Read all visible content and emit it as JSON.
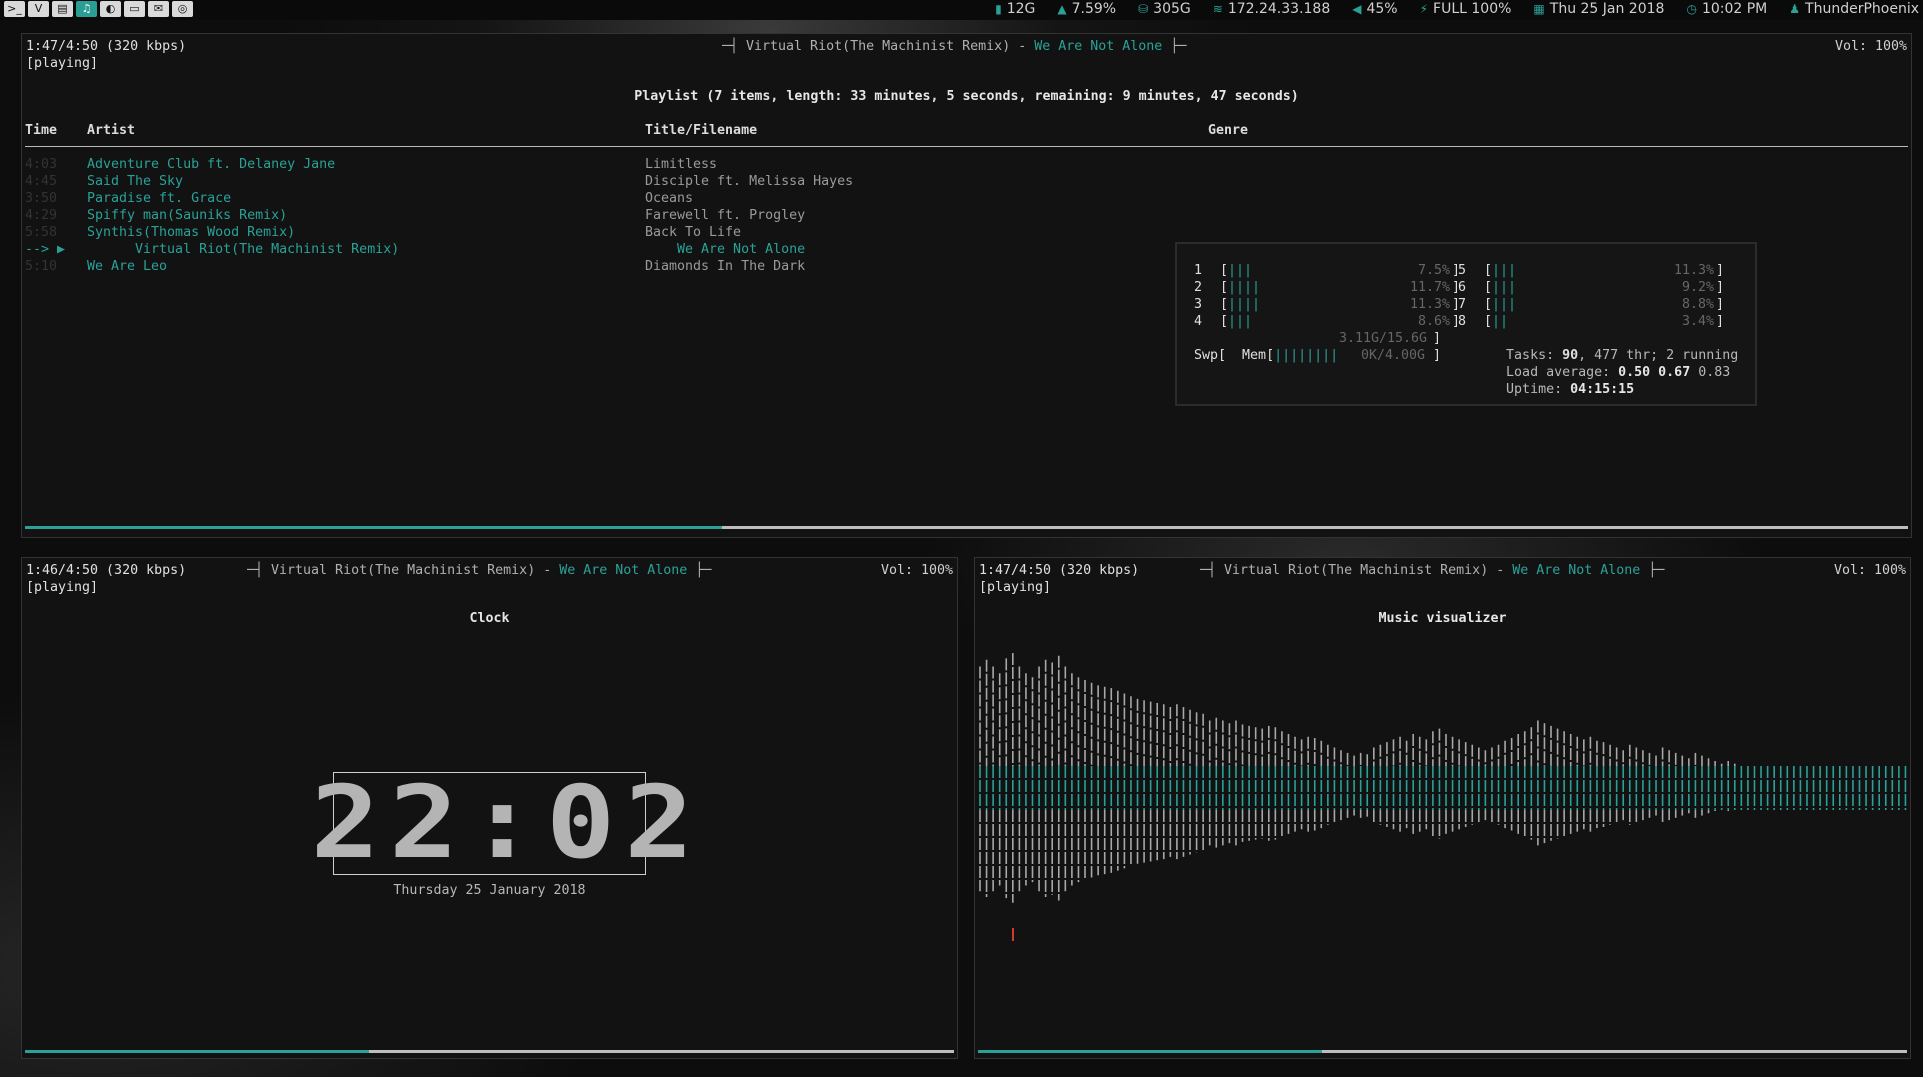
{
  "topbar": {
    "launchers": [
      ">_",
      "V",
      "▤",
      "♫",
      "◐",
      "▭",
      "✉",
      "◎"
    ],
    "status": [
      {
        "icon": "chip-icon",
        "glyph": "▮",
        "text": "12G"
      },
      {
        "icon": "cpu-graph-icon",
        "glyph": "▲",
        "text": "7.59%"
      },
      {
        "icon": "disk-icon",
        "glyph": "⛁",
        "text": "305G"
      },
      {
        "icon": "wifi-icon",
        "glyph": "≋",
        "text": "172.24.33.188"
      },
      {
        "icon": "volume-icon",
        "glyph": "◀",
        "text": "45%"
      },
      {
        "icon": "battery-plug-icon",
        "glyph": "⚡",
        "text": "FULL 100%"
      },
      {
        "icon": "calendar-icon",
        "glyph": "▦",
        "text": "Thu 25 Jan 2018"
      },
      {
        "icon": "clock-icon",
        "glyph": "◷",
        "text": "10:02 PM"
      },
      {
        "icon": "user-icon",
        "glyph": "♟",
        "text": "ThunderPhoenix"
      }
    ]
  },
  "playlist_pane": {
    "time": "1:47/4:50 (320 kbps)",
    "state": "[playing]",
    "title_left": "─┤ Virtual Riot(The Machinist Remix) - ",
    "title_song": "We Are Not Alone",
    "title_right": " ├─",
    "volume": "Vol: 100%",
    "summary": "Playlist (7 items, length: 33 minutes, 5 seconds, remaining: 9 minutes, 47 seconds)",
    "columns": {
      "time": "Time",
      "artist": "Artist",
      "title": "Title/Filename",
      "genre": "Genre"
    },
    "rows": [
      {
        "time": "4:03",
        "artist": "Adventure Club ft. Delaney Jane",
        "title": "Limitless"
      },
      {
        "time": "4:45",
        "artist": "Said The Sky",
        "title": "Disciple ft. Melissa Hayes"
      },
      {
        "time": "3:50",
        "artist": "Paradise ft. Grace",
        "title": "Oceans"
      },
      {
        "time": "4:29",
        "artist": "Spiffy man(Sauniks Remix)",
        "title": "Farewell ft. Progley"
      },
      {
        "time": "5:58",
        "artist": "Synthis(Thomas Wood Remix)",
        "title": "Back To Life"
      },
      {
        "time": "--> ▶",
        "artist": "      Virtual Riot(The Machinist Remix)",
        "title": "    We Are Not Alone",
        "current": true
      },
      {
        "time": "5:10",
        "artist": "We Are Leo",
        "title": "Diamonds In The Dark"
      }
    ],
    "progress": 0.37
  },
  "htop": {
    "cpus": [
      {
        "id": "1",
        "bar": "|||",
        "pct": "7.5%"
      },
      {
        "id": "2",
        "bar": "||||",
        "pct": "11.7%"
      },
      {
        "id": "3",
        "bar": "||||",
        "pct": "11.3%"
      },
      {
        "id": "4",
        "bar": "|||",
        "pct": "8.6%"
      },
      {
        "id": "5",
        "bar": "|||",
        "pct": "11.3%"
      },
      {
        "id": "6",
        "bar": "|||",
        "pct": "9.2%"
      },
      {
        "id": "7",
        "bar": "|||",
        "pct": "8.8%"
      },
      {
        "id": "8",
        "bar": "||",
        "pct": "3.4%"
      }
    ],
    "mem_label": "Mem[",
    "mem_bar": "||||||||",
    "mem_val": "3.11G/15.6G",
    "swp_label": "Swp[",
    "swp_val": "0K/4.00G",
    "tasks_label": "Tasks: ",
    "tasks": "90",
    "thr": ", 477 thr; 2 running",
    "load_label": "Load average: ",
    "load1": "0.50",
    "load5": "0.67",
    "load15": " 0.83",
    "uptime_label": "Uptime: ",
    "uptime": "04:15:15"
  },
  "clock_pane": {
    "time": "1:46/4:50 (320 kbps)",
    "state": "[playing]",
    "title_left": "─┤ Virtual Riot(The Machinist Remix) - ",
    "title_song": "We Are Not Alone",
    "title_right": " ├─",
    "volume": "Vol: 100%",
    "heading": "Clock",
    "digits": "22:02",
    "date": "Thursday 25 January 2018",
    "progress": 0.37
  },
  "viz_pane": {
    "time": "1:47/4:50 (320 kbps)",
    "state": "[playing]",
    "title_left": "─┤ Virtual Riot(The Machinist Remix) - ",
    "title_song": "We Are Not Alone",
    "title_right": " ├─",
    "volume": "Vol: 100%",
    "heading": "Music visualizer",
    "progress": 0.37,
    "amplitudes": [
      0.9,
      0.95,
      0.9,
      0.85,
      0.96,
      1.0,
      0.9,
      0.85,
      0.82,
      0.9,
      0.95,
      0.93,
      0.98,
      0.9,
      0.85,
      0.82,
      0.8,
      0.78,
      0.76,
      0.75,
      0.74,
      0.72,
      0.7,
      0.68,
      0.66,
      0.65,
      0.64,
      0.63,
      0.62,
      0.6,
      0.62,
      0.6,
      0.58,
      0.56,
      0.55,
      0.5,
      0.52,
      0.5,
      0.48,
      0.5,
      0.47,
      0.46,
      0.45,
      0.44,
      0.46,
      0.45,
      0.42,
      0.4,
      0.38,
      0.36,
      0.38,
      0.37,
      0.35,
      0.32,
      0.3,
      0.28,
      0.26,
      0.24,
      0.26,
      0.25,
      0.3,
      0.32,
      0.34,
      0.36,
      0.38,
      0.35,
      0.4,
      0.38,
      0.36,
      0.42,
      0.44,
      0.4,
      0.38,
      0.36,
      0.34,
      0.32,
      0.3,
      0.28,
      0.3,
      0.32,
      0.35,
      0.37,
      0.4,
      0.42,
      0.45,
      0.5,
      0.48,
      0.46,
      0.44,
      0.42,
      0.4,
      0.38,
      0.36,
      0.38,
      0.35,
      0.34,
      0.32,
      0.3,
      0.28,
      0.32,
      0.3,
      0.28,
      0.26,
      0.24,
      0.3,
      0.28,
      0.26,
      0.24,
      0.22,
      0.26,
      0.24,
      0.22,
      0.2,
      0.18,
      0.2,
      0.18,
      0.16,
      0.15,
      0.14,
      0.16,
      0.14,
      0.12,
      0.14,
      0.12,
      0.1,
      0.12,
      0.1,
      0.08,
      0.12,
      0.1,
      0.08,
      0.1,
      0.08,
      0.06,
      0.08,
      0.06,
      0.05,
      0.04,
      0.06,
      0.04,
      0.03,
      0.02
    ]
  },
  "colors": {
    "accent": "#2aa198",
    "bar_grey": "#a8a8a8",
    "peak_red": "#d33a2f"
  }
}
